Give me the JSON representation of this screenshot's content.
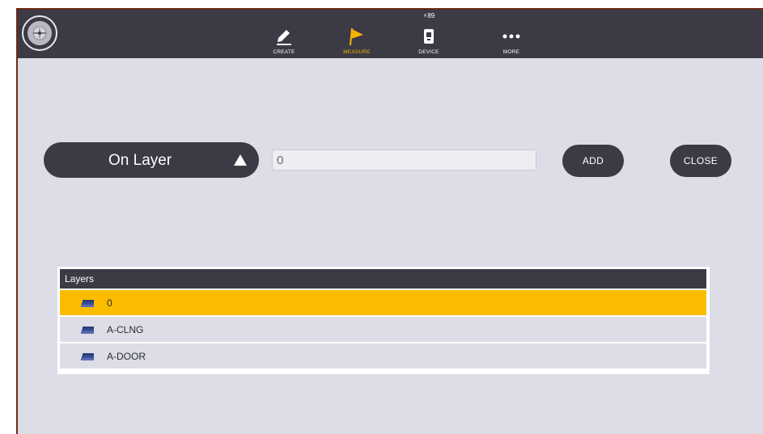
{
  "toolbar": {
    "items": [
      {
        "label": "CREATE",
        "icon": "pencil-icon",
        "active": false
      },
      {
        "label": "MEASURE",
        "icon": "flag-icon",
        "active": true
      },
      {
        "label": "DEVICE",
        "icon": "device-icon",
        "active": false,
        "badge": "89"
      },
      {
        "label": "MORE",
        "icon": "more-dots-icon",
        "active": false
      }
    ]
  },
  "controls": {
    "selector_label": "On Layer",
    "input_value": "0",
    "add_label": "ADD",
    "close_label": "CLOSE"
  },
  "layers": {
    "header": "Layers",
    "rows": [
      {
        "name": "0",
        "selected": true
      },
      {
        "name": "A-CLNG",
        "selected": false
      },
      {
        "name": "A-DOOR",
        "selected": false
      }
    ]
  },
  "colors": {
    "dark": "#3b3a45",
    "background": "#dcdde6",
    "accent": "#fbbc00"
  }
}
